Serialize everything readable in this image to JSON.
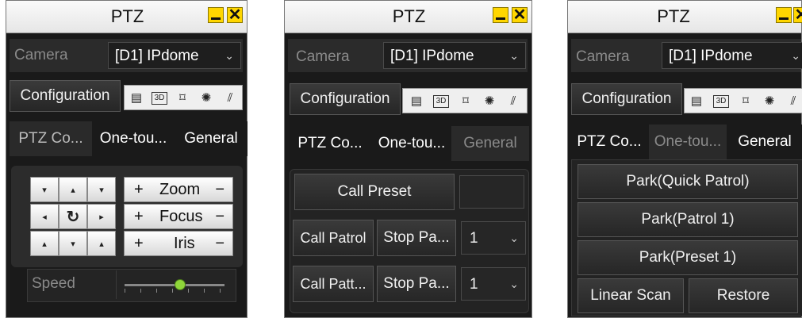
{
  "panels": [
    {
      "title": "PTZ",
      "camera_label": "Camera",
      "camera_value": "[D1] IPdome",
      "config_label": "Configuration",
      "tabs": [
        "PTZ Co...",
        "One-tou...",
        "General"
      ],
      "controls": {
        "zoom": "Zoom",
        "focus": "Focus",
        "iris": "Iris",
        "plus": "+",
        "minus": "−"
      },
      "speed_label": "Speed",
      "speed_level": 0.55
    },
    {
      "title": "PTZ",
      "camera_label": "Camera",
      "camera_value": "[D1] IPdome",
      "config_label": "Configuration",
      "tabs": [
        "PTZ Co...",
        "One-tou...",
        "General"
      ],
      "call_preset": "Call Preset",
      "call_patrol": "Call Patrol",
      "stop_patrol": "Stop Pa...",
      "patrol_value": "1",
      "call_pattern": "Call Patt...",
      "stop_pattern": "Stop Pa...",
      "pattern_value": "1"
    },
    {
      "title": "PTZ",
      "camera_label": "Camera",
      "camera_value": "[D1] IPdome",
      "config_label": "Configuration",
      "tabs": [
        "PTZ Co...",
        "One-tou...",
        "General"
      ],
      "park_quick": "Park(Quick Patrol)",
      "park_patrol": "Park(Patrol 1)",
      "park_preset": "Park(Preset 1)",
      "linear_scan": "Linear Scan",
      "restore": "Restore"
    }
  ],
  "icons": [
    "menu-icon",
    "3d-icon",
    "region-icon",
    "light-icon",
    "wiper-icon"
  ],
  "colors": {
    "title_bg": "#f2f2f2",
    "window_button": "#ffd600",
    "panel_bg": "#1a1a1a",
    "speed_knob": "#8fd63a"
  }
}
